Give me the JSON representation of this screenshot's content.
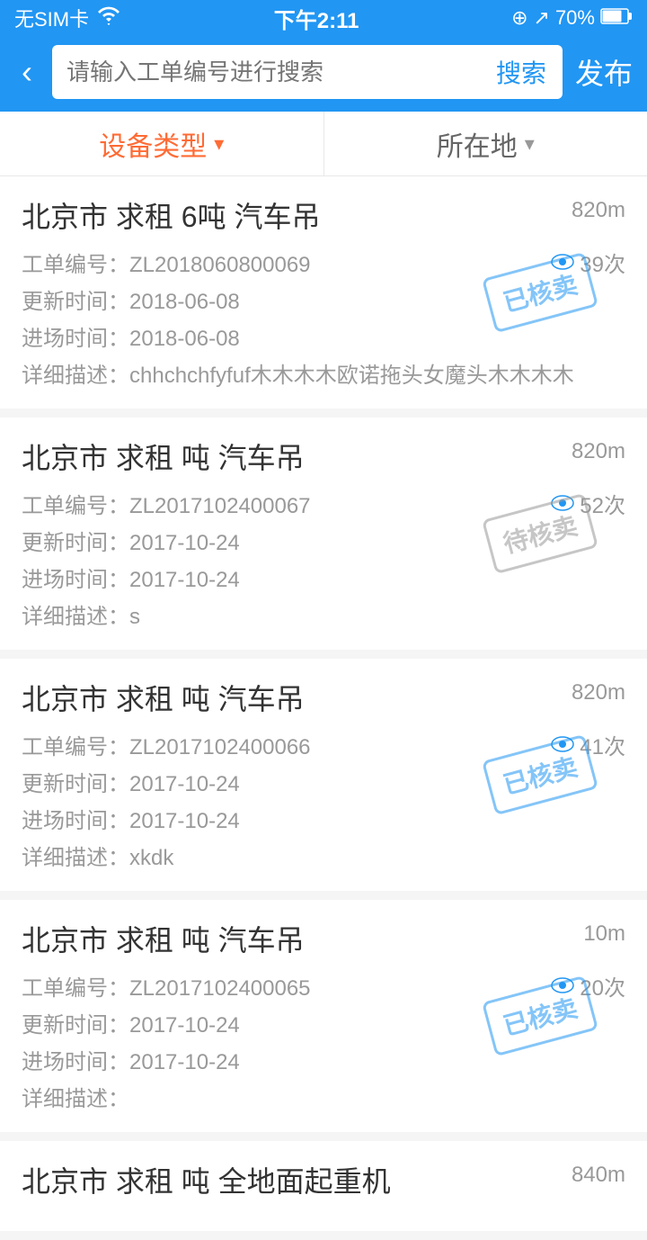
{
  "statusBar": {
    "left": "无SIM卡 ▲",
    "time": "下午2:11",
    "battery": "70%",
    "icons": "⊕ ↗ 70%"
  },
  "header": {
    "back_label": "‹",
    "search_placeholder": "请输入工单编号进行搜索",
    "search_btn": "搜索",
    "publish_btn": "发布"
  },
  "filterBar": {
    "type_label": "设备类型",
    "location_label": "所在地"
  },
  "items": [
    {
      "title": "北京市 求租 6吨 汽车吊",
      "distance": "820m",
      "order_no": "工单编号：ZL2018060800069",
      "views": "39次",
      "update_time": "更新时间：2018-06-08",
      "entry_time": "进场时间：2018-06-08",
      "description": "详细描述：chhchchfyfuf木木木木欧诺拖头女魔头木木木木",
      "stamp": "已核卖",
      "stamp_type": "sold"
    },
    {
      "title": "北京市 求租 吨 汽车吊",
      "distance": "820m",
      "order_no": "工单编号：ZL2017102400067",
      "views": "52次",
      "update_time": "更新时间：2017-10-24",
      "entry_time": "进场时间：2017-10-24",
      "description": "详细描述：s",
      "stamp": "待核卖",
      "stamp_type": "pending"
    },
    {
      "title": "北京市 求租 吨 汽车吊",
      "distance": "820m",
      "order_no": "工单编号：ZL2017102400066",
      "views": "41次",
      "update_time": "更新时间：2017-10-24",
      "entry_time": "进场时间：2017-10-24",
      "description": "详细描述：xkdk",
      "stamp": "已核卖",
      "stamp_type": "sold"
    },
    {
      "title": "北京市 求租 吨 汽车吊",
      "distance": "10m",
      "order_no": "工单编号：ZL2017102400065",
      "views": "20次",
      "update_time": "更新时间：2017-10-24",
      "entry_time": "进场时间：2017-10-24",
      "description": "详细描述：",
      "stamp": "已核卖",
      "stamp_type": "sold"
    },
    {
      "title": "北京市 求租 吨 全地面起重机",
      "distance": "840m",
      "order_no": "",
      "views": "",
      "update_time": "",
      "entry_time": "",
      "description": "",
      "stamp": "",
      "stamp_type": ""
    }
  ]
}
